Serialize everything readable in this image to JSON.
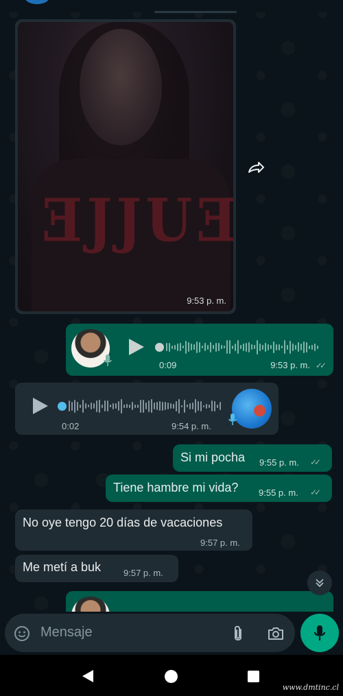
{
  "colors": {
    "chat_background": "#0b141a",
    "outgoing_bubble": "#005c4b",
    "incoming_bubble": "#202c33",
    "accent_green": "#00a884",
    "unread_dot_blue": "#53bdeb"
  },
  "messages": {
    "image": {
      "time": "9:53 p. m.",
      "icon": "forward-icon"
    },
    "voice_out": {
      "duration": "0:09",
      "time": "9:53 p. m.",
      "status": "read"
    },
    "voice_in": {
      "duration": "0:02",
      "time": "9:54 p. m."
    },
    "text_1": {
      "text": "Si mi pocha",
      "time": "9:55 p. m."
    },
    "text_2": {
      "text": "Tiene hambre mi vida?",
      "time": "9:55 p. m."
    },
    "text_3": {
      "text": "No oye tengo 20 días de vacaciones",
      "time": "9:57 p. m."
    },
    "text_4": {
      "text": "Me metí a buk",
      "time": "9:57 p. m."
    }
  },
  "input": {
    "placeholder": "Mensaje",
    "emoji_icon": "emoji-icon",
    "attach_icon": "paperclip-icon",
    "camera_icon": "camera-icon",
    "mic_icon": "microphone-icon"
  },
  "scroll_button": {
    "icon": "double-chevron-down-icon"
  },
  "navigation": {
    "back": "back-triangle",
    "home": "home-circle",
    "recent": "recents-square"
  },
  "watermark": "www.dmtinc.cl"
}
